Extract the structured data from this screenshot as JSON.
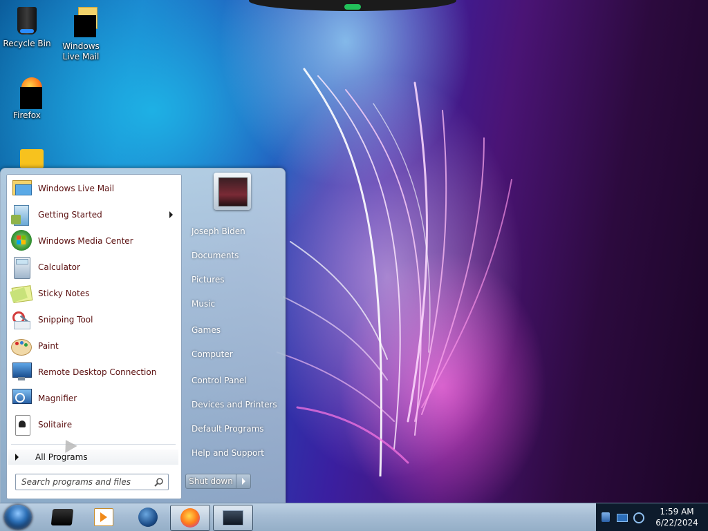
{
  "desktop": {
    "icons": [
      {
        "label": "Recycle Bin",
        "icon": "recycle-bin-icon"
      },
      {
        "label": "Windows Live Mail",
        "icon": "windows-live-mail-icon"
      },
      {
        "label": "Firefox",
        "icon": "firefox-icon"
      }
    ]
  },
  "start_menu": {
    "programs": [
      {
        "label": "Windows Live Mail",
        "icon": "windows-live-mail-icon"
      },
      {
        "label": "Getting Started",
        "icon": "getting-started-icon",
        "has_submenu": true
      },
      {
        "label": "Windows Media Center",
        "icon": "windows-media-center-icon"
      },
      {
        "label": "Calculator",
        "icon": "calculator-icon"
      },
      {
        "label": "Sticky Notes",
        "icon": "sticky-notes-icon"
      },
      {
        "label": "Snipping Tool",
        "icon": "snipping-tool-icon"
      },
      {
        "label": "Paint",
        "icon": "paint-icon"
      },
      {
        "label": "Remote Desktop Connection",
        "icon": "remote-desktop-icon"
      },
      {
        "label": "Magnifier",
        "icon": "magnifier-icon"
      },
      {
        "label": "Solitaire",
        "icon": "solitaire-icon"
      }
    ],
    "all_programs_label": "All Programs",
    "search_placeholder": "Search programs and files",
    "right_links": [
      "Joseph Biden",
      "Documents",
      "Pictures",
      "Music",
      "Games",
      "Computer",
      "Control Panel",
      "Devices and Printers",
      "Default Programs",
      "Help and Support"
    ],
    "shutdown_label": "Shut down"
  },
  "taskbar": {
    "pinned": [
      {
        "name": "taskbar-app-1",
        "icon": "app-window-icon"
      },
      {
        "name": "taskbar-media-player",
        "icon": "media-player-icon"
      },
      {
        "name": "taskbar-globe",
        "icon": "globe-icon"
      },
      {
        "name": "taskbar-firefox",
        "icon": "firefox-icon"
      },
      {
        "name": "taskbar-explorer",
        "icon": "explorer-window-icon"
      }
    ],
    "clock": {
      "time": "1:59 AM",
      "date": "6/22/2024"
    }
  },
  "colors": {
    "program_text": "#5a0f0f",
    "tray_bg": "#0d1b2c",
    "taskbar_top": "#bcd0e3"
  }
}
